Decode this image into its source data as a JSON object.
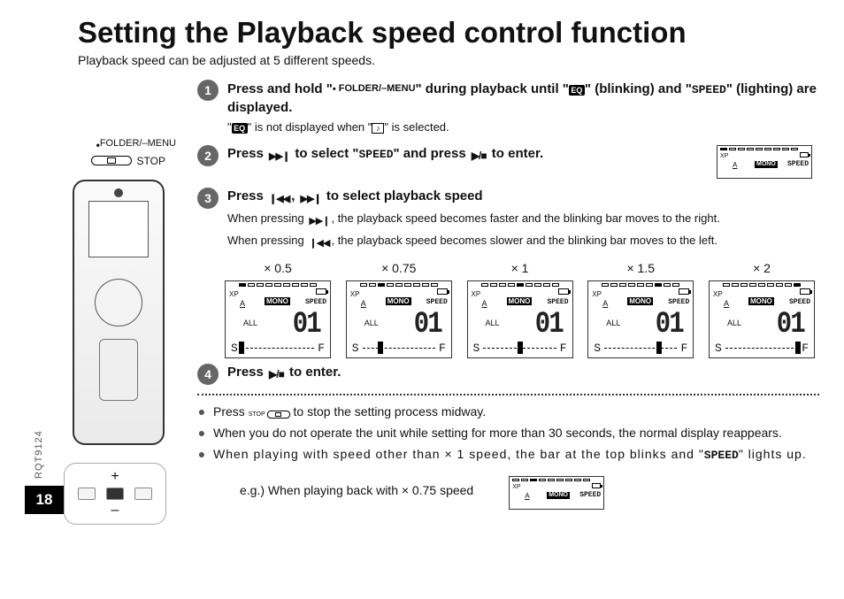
{
  "ref": "RQT9124",
  "page_number": "18",
  "title": "Setting the Playback speed control function",
  "subtitle": "Playback speed can be adjusted at 5 different speeds.",
  "device_label": {
    "folder_menu": "FOLDER/–MENU",
    "stop": "STOP"
  },
  "steps": {
    "s1": {
      "num": "1",
      "prefix": "Press and hold \"",
      "mid": "\" during playback until \"",
      "mid2": "\" (blinking) and \"",
      "suffix": "\" (lighting) are displayed.",
      "sub_prefix": "\"",
      "sub_mid": "\" is not displayed when \"",
      "sub_suffix": "\" is selected.",
      "icon_eq": "EQ",
      "icon_speed": "SPEED"
    },
    "s2": {
      "num": "2",
      "prefix": "Press ",
      "mid": " to select \"",
      "mid2": "\" and press ",
      "suffix": " to enter.",
      "icon_speed": "SPEED"
    },
    "s3": {
      "num": "3",
      "title_prefix": "Press ",
      "title_mid": ", ",
      "title_suffix": " to select playback speed",
      "line_fwd_prefix": "When pressing ",
      "line_fwd_suffix": ", the playback speed becomes faster and the blinking bar moves to the right.",
      "line_back_prefix": "When pressing ",
      "line_back_suffix": ", the playback speed becomes slower and the blinking bar moves to the left."
    },
    "s4": {
      "num": "4",
      "prefix": "Press ",
      "suffix": " to enter."
    }
  },
  "mini_lcd_labels": {
    "xp": "XP",
    "mono": "MONO",
    "speed": "SPEED",
    "a": "A",
    "all": "ALL"
  },
  "speed_options": [
    {
      "label": "× 0.5",
      "marker_pct": 0
    },
    {
      "label": "× 0.75",
      "marker_pct": 25
    },
    {
      "label": "× 1",
      "marker_pct": 50
    },
    {
      "label": "× 1.5",
      "marker_pct": 75
    },
    {
      "label": "× 2",
      "marker_pct": 100
    }
  ],
  "lcd_digits": "01",
  "sf": {
    "s": "S",
    "f": "F"
  },
  "bullets": {
    "b1_prefix": "Press ",
    "b1_suffix": " to stop the setting process midway.",
    "b1_stop": "STOP",
    "b2": "When you do not operate the unit while setting for more than 30 seconds, the normal display reappears.",
    "b3_prefix": "When playing with speed other than × 1 speed, the bar at the top blinks and \"",
    "b3_speed": "SPEED",
    "b3_suffix": "\" lights up."
  },
  "eg_line": "e.g.) When playing back with × 0.75 speed",
  "eg_marker_pct": 25
}
